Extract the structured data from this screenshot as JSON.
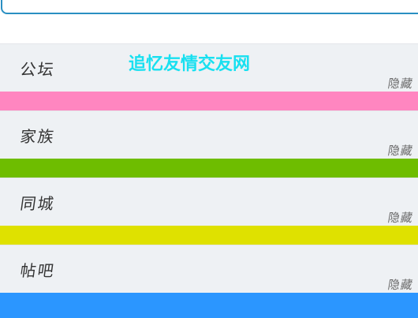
{
  "header": {
    "site_title": "追忆友情交友网"
  },
  "sections": [
    {
      "label": "公坛",
      "toggle_label": "隐藏",
      "bar_color": "#ff86c0"
    },
    {
      "label": "家族",
      "toggle_label": "隐藏",
      "bar_color": "#6ebd00"
    },
    {
      "label": "同城",
      "toggle_label": "隐藏",
      "bar_color": "#dfe100"
    },
    {
      "label": "帖吧",
      "toggle_label": "隐藏",
      "bar_color": "#2b96ff"
    }
  ],
  "colors": {
    "title": "#18e0f0",
    "section_bg": "#eef1f4",
    "top_border": "#2a8fc2"
  }
}
